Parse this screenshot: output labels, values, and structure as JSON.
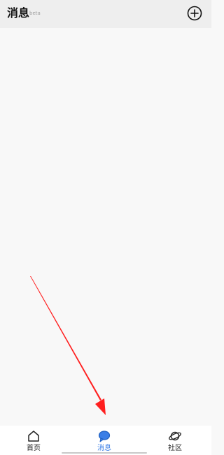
{
  "header": {
    "title": "消息",
    "badge": "beta",
    "add_icon": "plus-circle-icon"
  },
  "tabbar": {
    "tabs": [
      {
        "label": "首页",
        "icon": "home-icon",
        "active": false
      },
      {
        "label": "消息",
        "icon": "chat-bubble-icon",
        "active": true
      },
      {
        "label": "社区",
        "icon": "planet-icon",
        "active": false
      }
    ]
  },
  "annotation": {
    "arrow_color": "#ff1f1f"
  },
  "colors": {
    "accent": "#3a7ee6",
    "header_bg": "#eeeeee",
    "content_bg": "#f8f8f8"
  }
}
